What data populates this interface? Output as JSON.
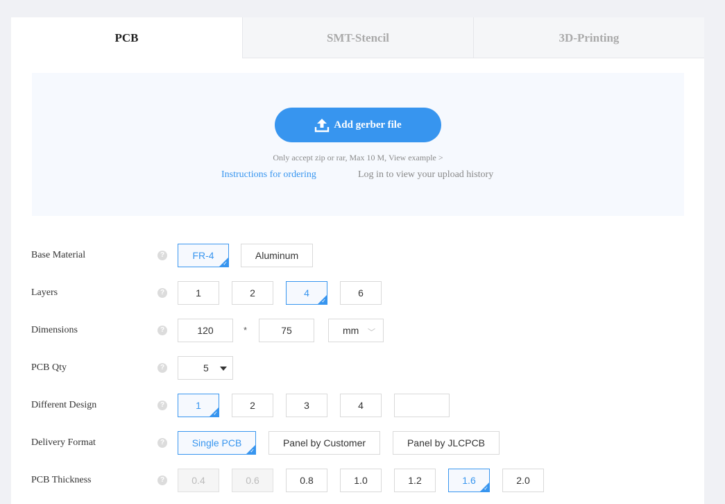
{
  "tabs": [
    {
      "label": "PCB",
      "active": true
    },
    {
      "label": "SMT-Stencil",
      "active": false
    },
    {
      "label": "3D-Printing",
      "active": false
    }
  ],
  "upload": {
    "button_label": "Add gerber file",
    "hint": "Only accept zip or rar, Max 10 M, View example >",
    "instructions_link": "Instructions for ordering",
    "history_link": "Log in to view your upload history"
  },
  "form": {
    "base_material": {
      "label": "Base Material",
      "options": [
        "FR-4",
        "Aluminum"
      ],
      "selected": "FR-4"
    },
    "layers": {
      "label": "Layers",
      "options": [
        "1",
        "2",
        "4",
        "6"
      ],
      "selected": "4"
    },
    "dimensions": {
      "label": "Dimensions",
      "width": "120",
      "separator": "*",
      "height": "75",
      "unit": "mm"
    },
    "pcb_qty": {
      "label": "PCB Qty",
      "value": "5"
    },
    "different_design": {
      "label": "Different Design",
      "options": [
        "1",
        "2",
        "3",
        "4"
      ],
      "custom_value": "",
      "selected": "1"
    },
    "delivery_format": {
      "label": "Delivery Format",
      "options": [
        "Single PCB",
        "Panel by Customer",
        "Panel by JLCPCB"
      ],
      "selected": "Single PCB"
    },
    "pcb_thickness": {
      "label": "PCB Thickness",
      "options": [
        "0.4",
        "0.6",
        "0.8",
        "1.0",
        "1.2",
        "1.6",
        "2.0"
      ],
      "disabled": [
        "0.4",
        "0.6"
      ],
      "selected": "1.6"
    }
  },
  "icons": {
    "upload": "upload-icon",
    "help": "question-circle-icon",
    "check": "check-icon",
    "dropdown": "chevron-down-icon"
  },
  "colors": {
    "accent": "#3795ef",
    "page_bg": "#f0f1f5",
    "upload_bg": "#f6f9fe"
  }
}
